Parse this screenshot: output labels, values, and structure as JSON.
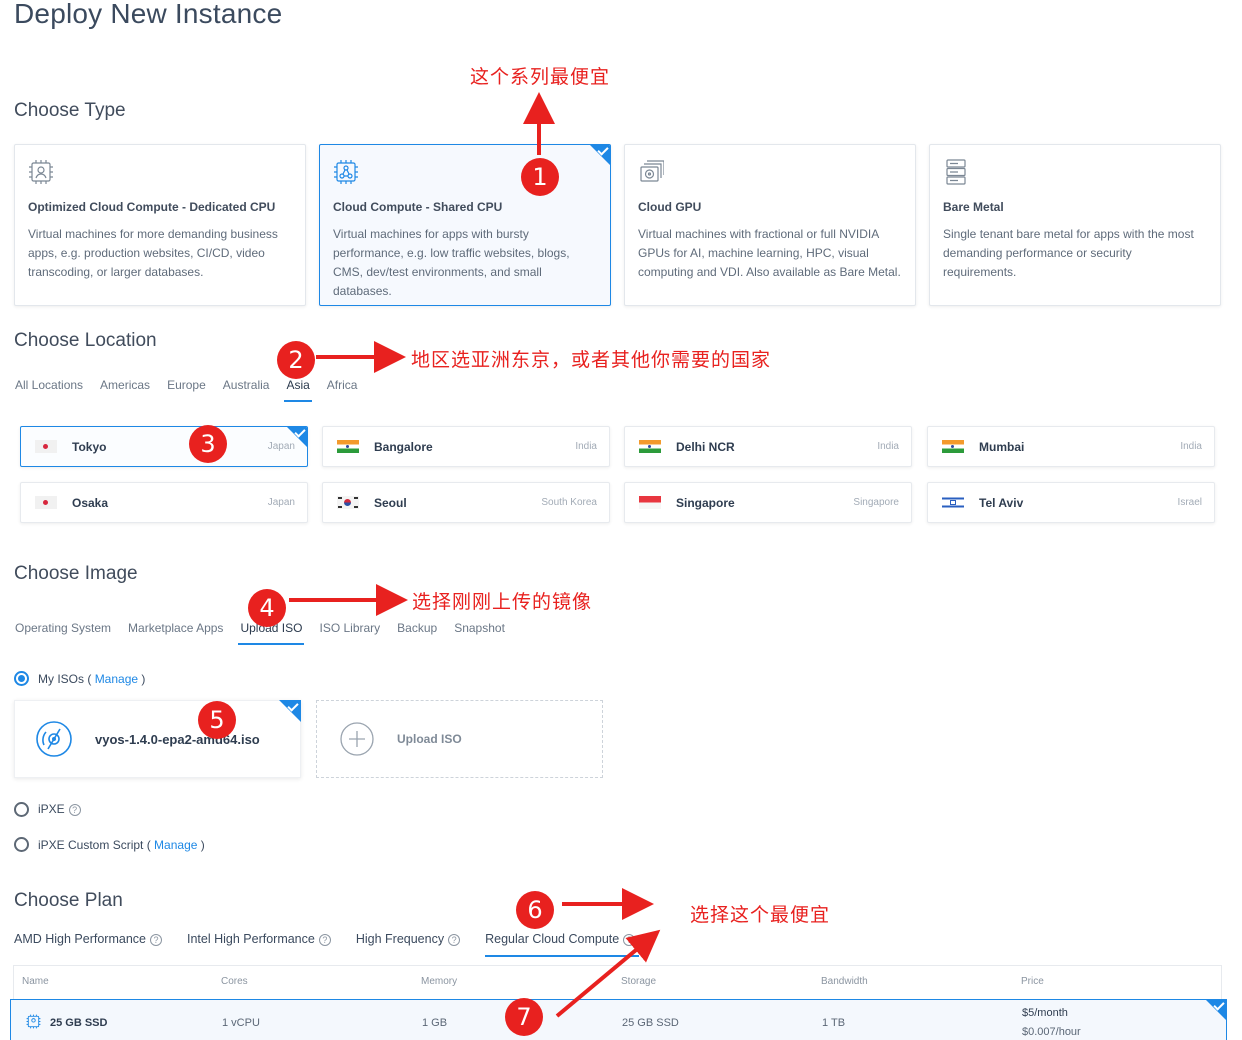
{
  "page": {
    "title": "Deploy New Instance"
  },
  "type_section": {
    "heading": "Choose Type",
    "cards": [
      {
        "title": "Optimized Cloud Compute - Dedicated CPU",
        "desc": "Virtual machines for more demanding business apps, e.g. production websites, CI/CD, video transcoding, or larger databases.",
        "selected": false,
        "icon": "cpu-user-icon"
      },
      {
        "title": "Cloud Compute - Shared CPU",
        "desc": "Virtual machines for apps with bursty performance, e.g. low traffic websites, blogs, CMS, dev/test environments, and small databases.",
        "selected": true,
        "icon": "cpu-network-icon"
      },
      {
        "title": "Cloud GPU",
        "desc": "Virtual machines with fractional or full NVIDIA GPUs for AI, machine learning, HPC, visual computing and VDI. Also available as Bare Metal.",
        "selected": false,
        "icon": "gpu-icon"
      },
      {
        "title": "Bare Metal",
        "desc": "Single tenant bare metal for apps with the most demanding performance or security requirements.",
        "selected": false,
        "icon": "server-icon"
      }
    ]
  },
  "location_section": {
    "heading": "Choose Location",
    "tabs": [
      "All Locations",
      "Americas",
      "Europe",
      "Australia",
      "Asia",
      "Africa"
    ],
    "active_tab": "Asia",
    "locations": [
      {
        "city": "Tokyo",
        "country": "Japan",
        "flag": "japan",
        "selected": true
      },
      {
        "city": "Bangalore",
        "country": "India",
        "flag": "india",
        "selected": false
      },
      {
        "city": "Delhi NCR",
        "country": "India",
        "flag": "india",
        "selected": false
      },
      {
        "city": "Mumbai",
        "country": "India",
        "flag": "india",
        "selected": false
      },
      {
        "city": "Osaka",
        "country": "Japan",
        "flag": "japan",
        "selected": false
      },
      {
        "city": "Seoul",
        "country": "South Korea",
        "flag": "korea",
        "selected": false
      },
      {
        "city": "Singapore",
        "country": "Singapore",
        "flag": "singapore",
        "selected": false
      },
      {
        "city": "Tel Aviv",
        "country": "Israel",
        "flag": "israel",
        "selected": false
      }
    ]
  },
  "image_section": {
    "heading": "Choose Image",
    "tabs": [
      "Operating System",
      "Marketplace Apps",
      "Upload ISO",
      "ISO Library",
      "Backup",
      "Snapshot"
    ],
    "active_tab": "Upload ISO",
    "my_isos_label": "My ISOs (",
    "manage": "Manage",
    "close_paren": ")",
    "iso_name": "vyos-1.4.0-epa2-amd64.iso",
    "upload_label": "Upload ISO",
    "ipxe_label": "iPXE",
    "ipxe_custom_label": "iPXE Custom Script (",
    "ipxe_question": "?"
  },
  "plan_section": {
    "heading": "Choose Plan",
    "tabs": [
      "AMD High Performance",
      "Intel High Performance",
      "High Frequency",
      "Regular Cloud Compute"
    ],
    "active_tab": "Regular Cloud Compute",
    "tab_help": "?",
    "columns": [
      "Name",
      "Cores",
      "Memory",
      "Storage",
      "Bandwidth",
      "Price"
    ],
    "row": {
      "name": "25 GB SSD",
      "cores": "1 vCPU",
      "memory": "1 GB",
      "storage": "25 GB SSD",
      "bandwidth": "1 TB",
      "price_month": "$5/month",
      "price_hour": "$0.007/hour"
    }
  },
  "annotations": {
    "n1": "1",
    "n2": "2",
    "n3": "3",
    "n4": "4",
    "n5": "5",
    "n6": "6",
    "n7": "7",
    "note_type": "这个系列最便宜",
    "note_location": "地区选亚洲东京，或者其他你需要的国家",
    "note_image": "选择刚刚上传的镜像",
    "note_plan": "选择这个最便宜",
    "color": "#e8211f"
  },
  "colors": {
    "accent": "#1e88e5",
    "text": "#3b4a5e",
    "annotation": "#e8211f"
  }
}
